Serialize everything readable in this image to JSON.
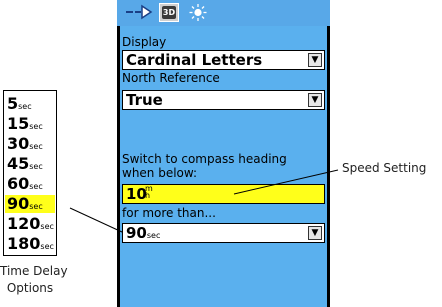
{
  "tab_bar": {
    "tabs": [
      {
        "icon": "route-icon"
      },
      {
        "icon": "3d-icon",
        "label": "3D"
      },
      {
        "icon": "sun-icon"
      }
    ]
  },
  "settings": {
    "display_label": "Display",
    "display_value": "Cardinal Letters",
    "north_reference_label": "North Reference",
    "north_reference_value": "True",
    "switch_label_line1": "Switch to compass heading",
    "switch_label_line2": "when below:",
    "speed_value": "10",
    "speed_unit_top": "m",
    "speed_unit_bottom": "h",
    "for_more_than_label": "for more than...",
    "time_delay_value": "90",
    "time_delay_unit": "sec"
  },
  "time_delay_options": [
    {
      "value": "5",
      "unit": "sec"
    },
    {
      "value": "15",
      "unit": "sec"
    },
    {
      "value": "30",
      "unit": "sec"
    },
    {
      "value": "45",
      "unit": "sec"
    },
    {
      "value": "60",
      "unit": "sec"
    },
    {
      "value": "90",
      "unit": "sec",
      "selected": true
    },
    {
      "value": "120",
      "unit": "sec"
    },
    {
      "value": "180",
      "unit": "sec"
    }
  ],
  "callouts": {
    "speed_setting": "Speed Setting",
    "time_delay_line1": "Time Delay",
    "time_delay_line2": "Options"
  },
  "colors": {
    "panel_blue": "#5ab0ee",
    "tab_bar_blue": "#58a8e8",
    "highlight_yellow": "#ffff1a"
  }
}
